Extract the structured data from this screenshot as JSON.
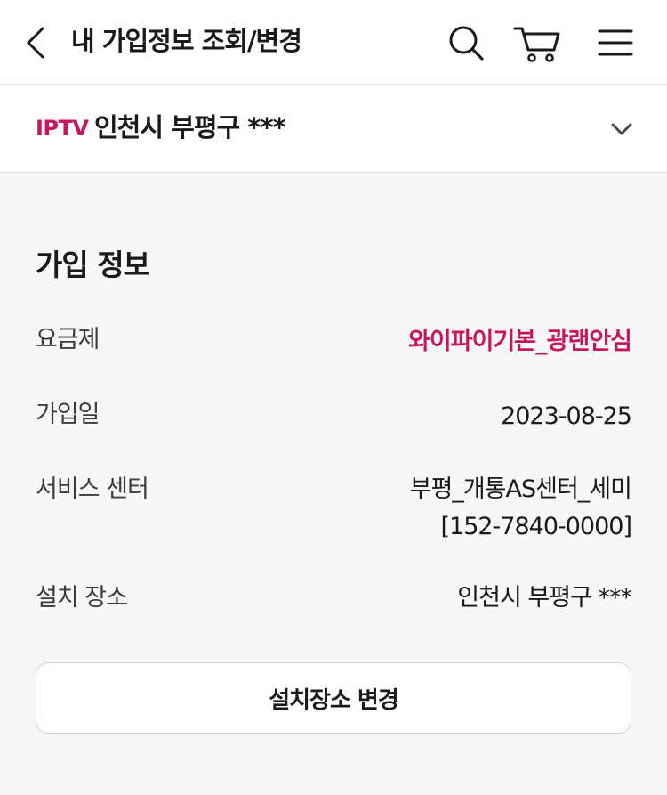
{
  "header": {
    "title": "내 가입정보 조회/변경",
    "icons": [
      "back-arrow-icon",
      "search-icon",
      "cart-icon",
      "hamburger-menu-icon"
    ]
  },
  "service": {
    "type": "IPTV",
    "address": "인천시 부평구 ***"
  },
  "subscription": {
    "section_title": "가입 정보",
    "rows": [
      {
        "label": "요금제",
        "value": "와이파이기본_광랜안심"
      },
      {
        "label": "가입일",
        "value": "2023-08-25"
      },
      {
        "label": "서비스 센터",
        "value": "부평_개통AS센터_세미",
        "value_line2": "[152-7840-0000]"
      },
      {
        "label": "설치 장소",
        "value": "인천시 부평구 ***"
      }
    ],
    "change_button": "설치장소 변경"
  },
  "colors": {
    "accent": "#c8165e",
    "text": "#1a1a1a",
    "label": "#3c3c3c",
    "divider": "#e2e2e2",
    "background": "#f7f7f7"
  }
}
